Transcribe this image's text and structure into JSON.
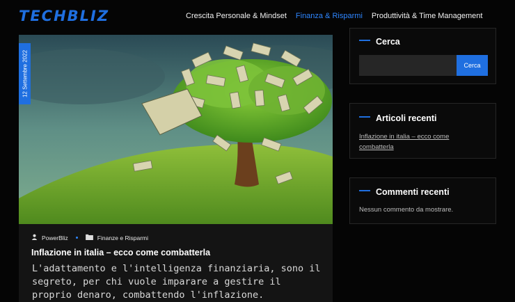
{
  "site": {
    "logo": "TECHBLIZ",
    "nav": [
      {
        "label": "Crescita Personale & Mindset",
        "active": false
      },
      {
        "label": "Finanza & Risparmi",
        "active": true
      },
      {
        "label": "Produttività & Time Management",
        "active": false
      }
    ]
  },
  "article": {
    "date": "12 Settembre 2022",
    "author": "PowerBliz",
    "category": "Finanze e Risparmi",
    "title": "Inflazione in italia – ecco come combatterla",
    "excerpt": "L'adattamento e l'intelligenza finanziaria, sono il segreto, per chi vuole imparare a gestire il proprio denaro, combattendo l'inflazione.",
    "image_icon": "money-tree-illustration"
  },
  "sidebar": {
    "search": {
      "title": "Cerca",
      "placeholder": "",
      "button": "Cerca"
    },
    "recent_posts": {
      "title": "Articoli recenti",
      "items": [
        "Inflazione in italia – ecco come combatterla"
      ]
    },
    "recent_comments": {
      "title": "Commenti recenti",
      "empty": "Nessun commento da mostrare."
    }
  },
  "colors": {
    "accent": "#1f6fe0",
    "nav_active": "#2e86ff",
    "background": "#050505"
  }
}
